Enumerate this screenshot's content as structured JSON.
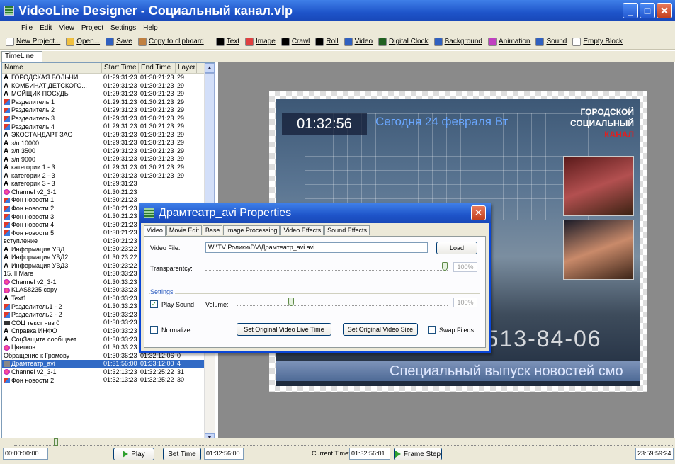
{
  "window": {
    "title": "VideoLine Designer - Социальный канал.vlp"
  },
  "menu": [
    "File",
    "Edit",
    "View",
    "Project",
    "Settings",
    "Help"
  ],
  "toolbar": [
    {
      "label": "New Project...",
      "icon": "new-project-icon",
      "color": "#ffffff"
    },
    {
      "label": "Open...",
      "icon": "open-folder-icon",
      "color": "#f0c040"
    },
    {
      "label": "Save",
      "icon": "save-icon",
      "color": "#3060c0"
    },
    {
      "label": "Copy to clipboard",
      "icon": "clipboard-icon",
      "color": "#c08040"
    },
    {
      "label": "Text",
      "icon": "text-icon",
      "color": "#000000"
    },
    {
      "label": "Image",
      "icon": "image-icon",
      "color": "#e04040"
    },
    {
      "label": "Crawl",
      "icon": "crawl-icon",
      "color": "#000000"
    },
    {
      "label": "Roll",
      "icon": "roll-icon",
      "color": "#000000"
    },
    {
      "label": "Video",
      "icon": "video-icon",
      "color": "#3060c0"
    },
    {
      "label": "Digital Clock",
      "icon": "digital-clock-icon",
      "color": "#206020"
    },
    {
      "label": "Background",
      "icon": "background-icon",
      "color": "#3060c0"
    },
    {
      "label": "Animation",
      "icon": "animation-icon",
      "color": "#c040c0"
    },
    {
      "label": "Sound",
      "icon": "sound-icon",
      "color": "#3060c0"
    },
    {
      "label": "Empty Block",
      "icon": "empty-block-icon",
      "color": "#ffffff"
    }
  ],
  "timeline_tab": "TimeLine",
  "columns": [
    "Name",
    "Start Time",
    "End Time",
    "Layer"
  ],
  "rows": [
    {
      "icon": "text",
      "name": "ГОРОДСКАЯ БОЛЬНИ...",
      "start": "01:29:31:23",
      "end": "01:30:21:23",
      "layer": "29"
    },
    {
      "icon": "text",
      "name": "КОМБИНАТ ДЕТСКОГО...",
      "start": "01:29:31:23",
      "end": "01:30:21:23",
      "layer": "29"
    },
    {
      "icon": "text",
      "name": "МОЙЩИК ПОСУДЫ",
      "start": "01:29:31:23",
      "end": "01:30:21:23",
      "layer": "29"
    },
    {
      "icon": "img",
      "name": "Разделитель 1",
      "start": "01:29:31:23",
      "end": "01:30:21:23",
      "layer": "29"
    },
    {
      "icon": "img",
      "name": "Разделитель 2",
      "start": "01:29:31:23",
      "end": "01:30:21:23",
      "layer": "29"
    },
    {
      "icon": "img",
      "name": "Разделитель 3",
      "start": "01:29:31:23",
      "end": "01:30:21:23",
      "layer": "29"
    },
    {
      "icon": "img",
      "name": "Разделитель 4",
      "start": "01:29:31:23",
      "end": "01:30:21:23",
      "layer": "29"
    },
    {
      "icon": "text",
      "name": "ЭКОСТАНДАРТ ЗАО",
      "start": "01:29:31:23",
      "end": "01:30:21:23",
      "layer": "29"
    },
    {
      "icon": "text",
      "name": "з/п 10000",
      "start": "01:29:31:23",
      "end": "01:30:21:23",
      "layer": "29"
    },
    {
      "icon": "text",
      "name": "з/п 3500",
      "start": "01:29:31:23",
      "end": "01:30:21:23",
      "layer": "29"
    },
    {
      "icon": "text",
      "name": "з/п 9000",
      "start": "01:29:31:23",
      "end": "01:30:21:23",
      "layer": "29"
    },
    {
      "icon": "text",
      "name": "категории 1 - 3",
      "start": "01:29:31:23",
      "end": "01:30:21:23",
      "layer": "29"
    },
    {
      "icon": "text",
      "name": "категории 2 - 3",
      "start": "01:29:31:23",
      "end": "01:30:21:23",
      "layer": "29"
    },
    {
      "icon": "text",
      "name": "категории 3 - 3",
      "start": "01:29:31:23",
      "end": "",
      "layer": ""
    },
    {
      "icon": "anim",
      "name": "Channel v2_3-1",
      "start": "01:30:21:23",
      "end": "",
      "layer": ""
    },
    {
      "icon": "img",
      "name": "Фон новости 1",
      "start": "01:30:21:23",
      "end": "",
      "layer": ""
    },
    {
      "icon": "img",
      "name": "Фон новости 2",
      "start": "01:30:21:23",
      "end": "",
      "layer": ""
    },
    {
      "icon": "img",
      "name": "Фон новости 3",
      "start": "01:30:21:23",
      "end": "",
      "layer": ""
    },
    {
      "icon": "img",
      "name": "Фон новости 4",
      "start": "01:30:21:23",
      "end": "",
      "layer": ""
    },
    {
      "icon": "img",
      "name": "Фон новости 5",
      "start": "01:30:21:23",
      "end": "",
      "layer": ""
    },
    {
      "icon": "video",
      "name": "вступление",
      "start": "01:30:21:23",
      "end": "",
      "layer": ""
    },
    {
      "icon": "text",
      "name": "Информация УВД",
      "start": "01:30:23:22",
      "end": "",
      "layer": ""
    },
    {
      "icon": "text",
      "name": "Информация УВД2",
      "start": "01:30:23:22",
      "end": "",
      "layer": ""
    },
    {
      "icon": "text",
      "name": "Информация УВД3",
      "start": "01:30:23:22",
      "end": "",
      "layer": ""
    },
    {
      "icon": "video",
      "name": "15. ll Mare",
      "start": "01:30:33:23",
      "end": "",
      "layer": ""
    },
    {
      "icon": "anim",
      "name": "Channel v2_3-1",
      "start": "01:30:33:23",
      "end": "",
      "layer": ""
    },
    {
      "icon": "anim",
      "name": "KLAS8235 copy",
      "start": "01:30:33:23",
      "end": "",
      "layer": ""
    },
    {
      "icon": "text",
      "name": "Text1",
      "start": "01:30:33:23",
      "end": "",
      "layer": ""
    },
    {
      "icon": "img",
      "name": "Разделитель1 - 2",
      "start": "01:30:33:23",
      "end": "",
      "layer": ""
    },
    {
      "icon": "img",
      "name": "Разделитель2 - 2",
      "start": "01:30:33:23",
      "end": "01:32:13:23",
      "layer": "30"
    },
    {
      "icon": "scroll",
      "name": "СОЦ текст низ 0",
      "start": "01:30:33:23",
      "end": "01:32:13:23",
      "layer": "30"
    },
    {
      "icon": "text",
      "name": "Справка ИНФО",
      "start": "01:30:33:23",
      "end": "01:32:13:23",
      "layer": "30"
    },
    {
      "icon": "text",
      "name": "СоцЗащита сообщает",
      "start": "01:30:33:23",
      "end": "01:32:13:23",
      "layer": "30"
    },
    {
      "icon": "anim",
      "name": "Цветков",
      "start": "01:30:33:23",
      "end": "01:32:13:23",
      "layer": "30"
    },
    {
      "icon": "video",
      "name": "Обращение к Громову",
      "start": "01:30:36:23",
      "end": "01:32:12:06",
      "layer": "0"
    },
    {
      "icon": "clip",
      "name": "Драмтеатр_avi",
      "start": "01:31:56:00",
      "end": "01:33:12:00",
      "layer": "4",
      "selected": true
    },
    {
      "icon": "anim",
      "name": "Channel v2_3-1",
      "start": "01:32:13:23",
      "end": "01:32:25:22",
      "layer": "31"
    },
    {
      "icon": "img",
      "name": "Фон новости 2",
      "start": "01:32:13:23",
      "end": "01:32:25:22",
      "layer": "30"
    }
  ],
  "preview": {
    "clock": "01:32:56",
    "date": "Сегодня 24 февраля Вт",
    "channel_lines": [
      "ГОРОДСКОЙ",
      "СОЦИАЛЬНЫЙ",
      "КАНАЛ"
    ],
    "side_text": "GE",
    "phone": "513-03-20, 513-84-06",
    "ticker": "Специальный выпуск новостей смо"
  },
  "dialog": {
    "title": "Драмтеатр_avi Properties",
    "tabs": [
      "Video",
      "Movie Edit",
      "Base",
      "Image Processing",
      "Video Effects",
      "Sound Effects"
    ],
    "video_file_label": "Video File:",
    "video_file_value": "W:\\TV Ролики\\DV\\Драмтеатр_avi.avi",
    "load_button": "Load",
    "transparency_label": "Transparentcy:",
    "transparency_value": "100%",
    "transparency_level": 1.0,
    "settings_label": "Settings",
    "play_sound_label": "Play Sound",
    "play_sound_checked": true,
    "volume_label": "Volume:",
    "volume_value": "100%",
    "volume_level": 0.25,
    "normalize_label": "Normalize",
    "normalize_checked": false,
    "set_live_time_button": "Set Original Video Live Time",
    "set_size_button": "Set Original Video Size",
    "swap_fields_label": "Swap Fileds",
    "swap_fields_checked": false
  },
  "bottom": {
    "time_start": "00:00:00:00",
    "play_button": "Play",
    "set_time_button": "Set Time",
    "set_time_value": "01:32:56:00",
    "current_time_label": "Current Time:",
    "current_time_value": "01:32:56:01",
    "frame_step_button": "Frame Step",
    "time_end": "23:59:59:24"
  }
}
